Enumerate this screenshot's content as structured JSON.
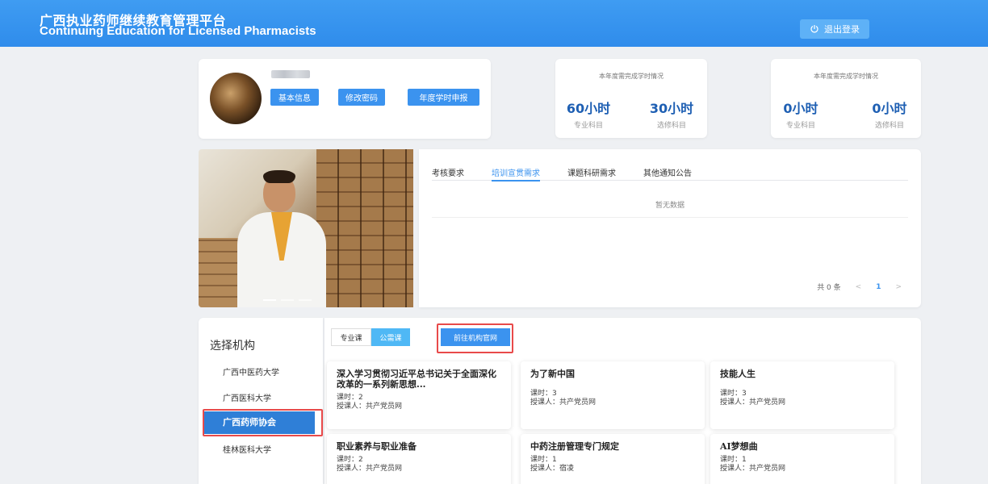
{
  "header": {
    "title_cn": "广西执业药师继续教育管理平台",
    "title_en": "Continuing Education for Licensed Pharmacists",
    "logout_label": "退出登录"
  },
  "profile": {
    "buttons": [
      "基本信息",
      "修改密码",
      "年度学时申报"
    ]
  },
  "stats": [
    {
      "title": "本年度需完成学时情况",
      "cols": [
        {
          "value": "60小时",
          "label": "专业科目"
        },
        {
          "value": "30小时",
          "label": "选修科目"
        }
      ]
    },
    {
      "title": "本年度需完成学时情况",
      "cols": [
        {
          "value": "0小时",
          "label": "专业科目"
        },
        {
          "value": "0小时",
          "label": "选修科目"
        }
      ]
    }
  ],
  "notices": {
    "tabs": [
      "考核要求",
      "培训宣贯需求",
      "课题科研需求",
      "其他通知公告"
    ],
    "active_tab_index": 1,
    "empty_text": "暂无数据",
    "pager": {
      "total": "共 0 条",
      "current": "1",
      "prev": "<",
      "next": ">"
    }
  },
  "institutions": {
    "title": "选择机构",
    "items": [
      "广西中医药大学",
      "广西医科大学",
      "广西药师协会",
      "桂林医科大学"
    ],
    "active_index": 2
  },
  "course_tabs": {
    "professional": "专业课",
    "public": "公需课",
    "goto_site": "前往机构官网"
  },
  "courses": [
    {
      "title": "深入学习贯彻习近平总书记关于全面深化改革的一系列新思想...",
      "hours": "课时：2",
      "teacher": "授课人：共产党员网"
    },
    {
      "title": "为了新中国",
      "hours": "课时：3",
      "teacher": "授课人：共产党员网"
    },
    {
      "title": "技能人生",
      "hours": "课时：3",
      "teacher": "授课人：共产党员网"
    },
    {
      "title": "职业素养与职业准备",
      "hours": "课时：2",
      "teacher": "授课人：共产党员网"
    },
    {
      "title": "中药注册管理专门规定",
      "hours": "课时：1",
      "teacher": "授课人：宿凌"
    },
    {
      "title": "AI梦想曲",
      "hours": "课时：1",
      "teacher": "授课人：共产党员网"
    }
  ],
  "colors": {
    "primary": "#3b93ef",
    "header": "#2f8ceb",
    "active_inst": "#2f7fd7",
    "highlight": "#e84a4a"
  }
}
